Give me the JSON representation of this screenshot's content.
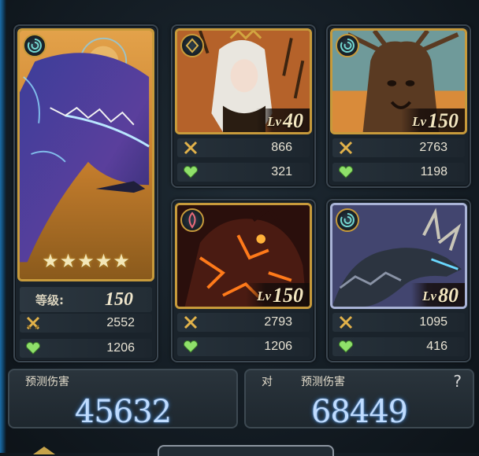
{
  "main_card": {
    "element_icon": "wind-spiral-icon",
    "stars": 5,
    "level_label": "等级:",
    "level_value": "150",
    "attack": "2552",
    "hp": "1206"
  },
  "cards": [
    {
      "element_icon": "earth-rune-icon",
      "lv_tag": "Lv",
      "lv": "40",
      "attack": "866",
      "hp": "321"
    },
    {
      "element_icon": "wind-spiral-icon",
      "lv_tag": "Lv",
      "lv": "150",
      "attack": "2763",
      "hp": "1198"
    },
    {
      "element_icon": "fire-rune-icon",
      "lv_tag": "Lv",
      "lv": "150",
      "attack": "2793",
      "hp": "1206"
    },
    {
      "element_icon": "wind-spiral-icon",
      "lv_tag": "Lv",
      "lv": "80",
      "attack": "1095",
      "hp": "416"
    }
  ],
  "predicted_damage": {
    "label": "预测伤害",
    "value": "45632"
  },
  "vs_predicted_damage": {
    "prefix": "对",
    "label": "预测伤害",
    "value": "68449",
    "help": "?"
  },
  "colors": {
    "gold_frame": "#c79a3b",
    "silver_frame": "#a9b3d6",
    "damage_glow": "#bfdcff"
  }
}
